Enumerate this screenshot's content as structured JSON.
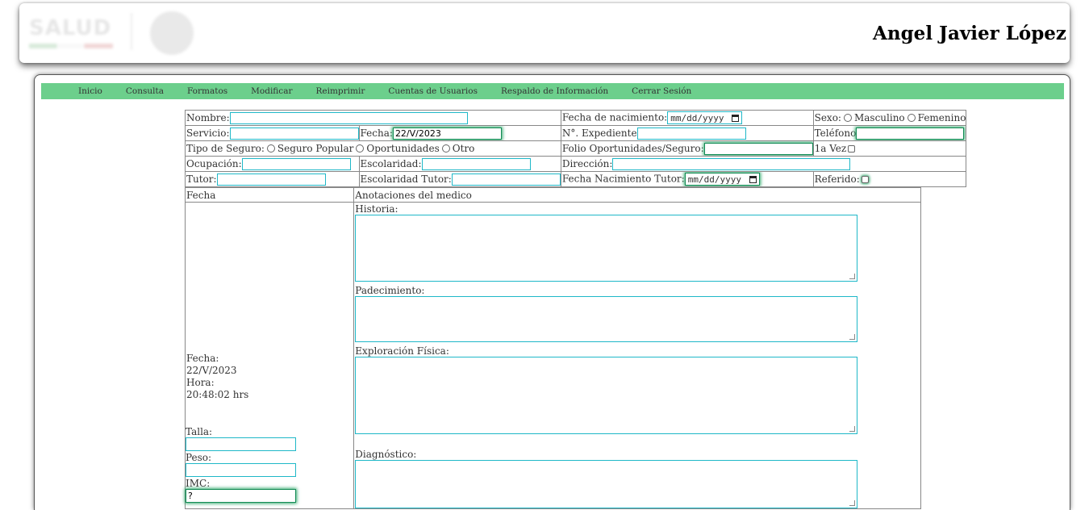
{
  "header": {
    "user_name": "Angel Javier López"
  },
  "nav": {
    "items": [
      "Inicio",
      "Consulta",
      "Formatos",
      "Modificar",
      "Reimprimir",
      "Cuentas de Usuarios",
      "Respaldo de Información",
      "Cerrar Sesión"
    ]
  },
  "form": {
    "nombre_label": "Nombre:",
    "nombre_value": "",
    "fecha_nac_label": "Fecha de nacimiento:",
    "fecha_nac_placeholder": "mm/dd/yyyy",
    "sexo_label": "Sexo:",
    "sexo_masculino": "Masculino",
    "sexo_femenino": "Femenino",
    "servicio_label": "Servicio:",
    "fecha_label": "Fecha:",
    "fecha_value": "22/V/2023",
    "expediente_label": "N°. Expediente",
    "telefono_label": "Teléfono",
    "tipo_seguro_label": "Tipo de Seguro:",
    "seguro_popular": "Seguro Popular",
    "oportunidades": "Oportunidades",
    "otro": "Otro",
    "folio_label": "Folio Oportunidades/Seguro:",
    "primera_vez_label": "1a Vez",
    "ocupacion_label": "Ocupación:",
    "escolaridad_label": "Escolaridad:",
    "direccion_label": "Dirección:",
    "tutor_label": "Tutor:",
    "escolaridad_tutor_label": "Escolaridad Tutor:",
    "fecha_nac_tutor_label": "Fecha Nacimiento Tutor:",
    "fecha_nac_tutor_placeholder": "mm/dd/yyyy",
    "referido_label": "Referido:"
  },
  "notes": {
    "col_fecha": "Fecha",
    "col_anotaciones": "Anotaciones del medico",
    "fecha_label": "Fecha:",
    "fecha_value": "22/V/2023",
    "hora_label": "Hora:",
    "hora_value": "20:48:02 hrs",
    "talla_label": "Talla:",
    "peso_label": "Peso:",
    "imc_label": "IMC:",
    "imc_value": "?",
    "historia_label": "Historia:",
    "padecimiento_label": "Padecimiento:",
    "exploracion_label": "Exploración Física:",
    "diagnostico_label": "Diagnóstico:"
  },
  "colors": {
    "nav_bg": "#6ccf8c",
    "input_border": "#1fb8c8",
    "focus_glow": "#2ea86a"
  }
}
